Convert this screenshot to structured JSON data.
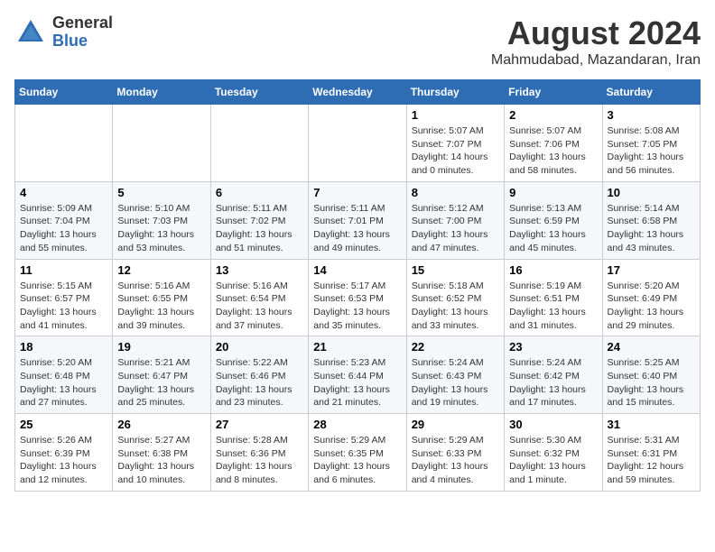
{
  "logo": {
    "general": "General",
    "blue": "Blue"
  },
  "title": "August 2024",
  "subtitle": "Mahmudabad, Mazandaran, Iran",
  "days_of_week": [
    "Sunday",
    "Monday",
    "Tuesday",
    "Wednesday",
    "Thursday",
    "Friday",
    "Saturday"
  ],
  "weeks": [
    [
      {
        "day": "",
        "content": ""
      },
      {
        "day": "",
        "content": ""
      },
      {
        "day": "",
        "content": ""
      },
      {
        "day": "",
        "content": ""
      },
      {
        "day": "1",
        "content": "Sunrise: 5:07 AM\nSunset: 7:07 PM\nDaylight: 14 hours\nand 0 minutes."
      },
      {
        "day": "2",
        "content": "Sunrise: 5:07 AM\nSunset: 7:06 PM\nDaylight: 13 hours\nand 58 minutes."
      },
      {
        "day": "3",
        "content": "Sunrise: 5:08 AM\nSunset: 7:05 PM\nDaylight: 13 hours\nand 56 minutes."
      }
    ],
    [
      {
        "day": "4",
        "content": "Sunrise: 5:09 AM\nSunset: 7:04 PM\nDaylight: 13 hours\nand 55 minutes."
      },
      {
        "day": "5",
        "content": "Sunrise: 5:10 AM\nSunset: 7:03 PM\nDaylight: 13 hours\nand 53 minutes."
      },
      {
        "day": "6",
        "content": "Sunrise: 5:11 AM\nSunset: 7:02 PM\nDaylight: 13 hours\nand 51 minutes."
      },
      {
        "day": "7",
        "content": "Sunrise: 5:11 AM\nSunset: 7:01 PM\nDaylight: 13 hours\nand 49 minutes."
      },
      {
        "day": "8",
        "content": "Sunrise: 5:12 AM\nSunset: 7:00 PM\nDaylight: 13 hours\nand 47 minutes."
      },
      {
        "day": "9",
        "content": "Sunrise: 5:13 AM\nSunset: 6:59 PM\nDaylight: 13 hours\nand 45 minutes."
      },
      {
        "day": "10",
        "content": "Sunrise: 5:14 AM\nSunset: 6:58 PM\nDaylight: 13 hours\nand 43 minutes."
      }
    ],
    [
      {
        "day": "11",
        "content": "Sunrise: 5:15 AM\nSunset: 6:57 PM\nDaylight: 13 hours\nand 41 minutes."
      },
      {
        "day": "12",
        "content": "Sunrise: 5:16 AM\nSunset: 6:55 PM\nDaylight: 13 hours\nand 39 minutes."
      },
      {
        "day": "13",
        "content": "Sunrise: 5:16 AM\nSunset: 6:54 PM\nDaylight: 13 hours\nand 37 minutes."
      },
      {
        "day": "14",
        "content": "Sunrise: 5:17 AM\nSunset: 6:53 PM\nDaylight: 13 hours\nand 35 minutes."
      },
      {
        "day": "15",
        "content": "Sunrise: 5:18 AM\nSunset: 6:52 PM\nDaylight: 13 hours\nand 33 minutes."
      },
      {
        "day": "16",
        "content": "Sunrise: 5:19 AM\nSunset: 6:51 PM\nDaylight: 13 hours\nand 31 minutes."
      },
      {
        "day": "17",
        "content": "Sunrise: 5:20 AM\nSunset: 6:49 PM\nDaylight: 13 hours\nand 29 minutes."
      }
    ],
    [
      {
        "day": "18",
        "content": "Sunrise: 5:20 AM\nSunset: 6:48 PM\nDaylight: 13 hours\nand 27 minutes."
      },
      {
        "day": "19",
        "content": "Sunrise: 5:21 AM\nSunset: 6:47 PM\nDaylight: 13 hours\nand 25 minutes."
      },
      {
        "day": "20",
        "content": "Sunrise: 5:22 AM\nSunset: 6:46 PM\nDaylight: 13 hours\nand 23 minutes."
      },
      {
        "day": "21",
        "content": "Sunrise: 5:23 AM\nSunset: 6:44 PM\nDaylight: 13 hours\nand 21 minutes."
      },
      {
        "day": "22",
        "content": "Sunrise: 5:24 AM\nSunset: 6:43 PM\nDaylight: 13 hours\nand 19 minutes."
      },
      {
        "day": "23",
        "content": "Sunrise: 5:24 AM\nSunset: 6:42 PM\nDaylight: 13 hours\nand 17 minutes."
      },
      {
        "day": "24",
        "content": "Sunrise: 5:25 AM\nSunset: 6:40 PM\nDaylight: 13 hours\nand 15 minutes."
      }
    ],
    [
      {
        "day": "25",
        "content": "Sunrise: 5:26 AM\nSunset: 6:39 PM\nDaylight: 13 hours\nand 12 minutes."
      },
      {
        "day": "26",
        "content": "Sunrise: 5:27 AM\nSunset: 6:38 PM\nDaylight: 13 hours\nand 10 minutes."
      },
      {
        "day": "27",
        "content": "Sunrise: 5:28 AM\nSunset: 6:36 PM\nDaylight: 13 hours\nand 8 minutes."
      },
      {
        "day": "28",
        "content": "Sunrise: 5:29 AM\nSunset: 6:35 PM\nDaylight: 13 hours\nand 6 minutes."
      },
      {
        "day": "29",
        "content": "Sunrise: 5:29 AM\nSunset: 6:33 PM\nDaylight: 13 hours\nand 4 minutes."
      },
      {
        "day": "30",
        "content": "Sunrise: 5:30 AM\nSunset: 6:32 PM\nDaylight: 13 hours\nand 1 minute."
      },
      {
        "day": "31",
        "content": "Sunrise: 5:31 AM\nSunset: 6:31 PM\nDaylight: 12 hours\nand 59 minutes."
      }
    ]
  ],
  "accent_color": "#2e6db4"
}
